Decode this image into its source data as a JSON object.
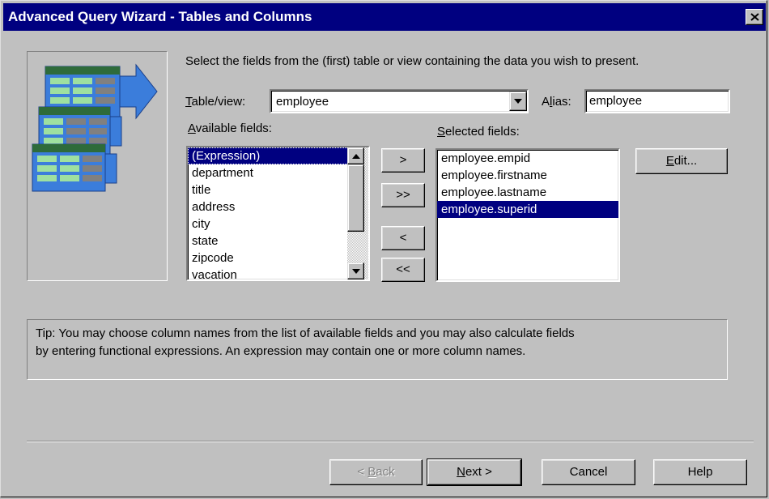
{
  "window": {
    "title": "Advanced Query Wizard - Tables and Columns"
  },
  "instructions": "Select the fields from the (first) table or view containing the data you wish to present.",
  "table_view": {
    "label_u": "T",
    "label_rest": "able/view:",
    "value": "employee"
  },
  "alias": {
    "label_pre": "A",
    "label_u": "l",
    "label_rest": "ias:",
    "value": "employee"
  },
  "available": {
    "label_u": "A",
    "label_rest": "vailable fields:",
    "items": [
      "(Expression)",
      "department",
      "title",
      "address",
      "city",
      "state",
      "zipcode",
      "vacation"
    ]
  },
  "selected": {
    "label_u": "S",
    "label_rest": "elected fields:",
    "items": [
      "employee.empid",
      "employee.firstname",
      "employee.lastname",
      "employee.superid"
    ]
  },
  "move_buttons": {
    "add": ">",
    "add_all": ">>",
    "remove": "<",
    "remove_all": "<<"
  },
  "edit_button": {
    "u": "E",
    "rest": "dit..."
  },
  "tip": {
    "line1": "Tip: You may choose column names from the list of available fields and you may also calculate fields",
    "line2": "by entering functional expressions.  An expression may contain one or more column names."
  },
  "footer": {
    "back": {
      "pre": "< ",
      "u": "B",
      "rest": "ack"
    },
    "next": {
      "u": "N",
      "rest": "ext >"
    },
    "cancel": "Cancel",
    "help": "Help"
  },
  "colors": {
    "titlebar": "#000080",
    "face": "#c0c0c0",
    "selection": "#000080",
    "icon_blue": "#3b7ddb",
    "icon_green": "#2e6b3a"
  }
}
